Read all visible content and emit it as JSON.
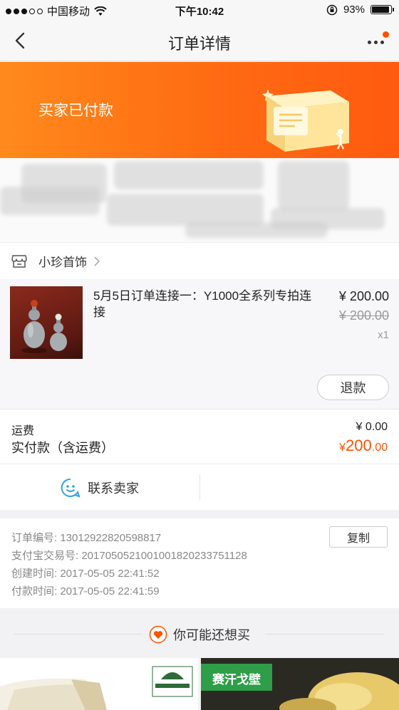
{
  "status_bar": {
    "carrier": "中国移动",
    "time": "下午10:42",
    "battery": "93%",
    "battery_level": 0.93
  },
  "nav": {
    "title": "订单详情"
  },
  "banner": {
    "status": "买家已付款"
  },
  "shop": {
    "name": "小珍首饰"
  },
  "product": {
    "name": "5月5日订单连接一：Y1000全系列专拍连接",
    "price": "¥ 200.00",
    "original_price": "¥ 200.00",
    "quantity": "x1",
    "refund_label": "退款"
  },
  "totals": {
    "shipping_label": "运费",
    "shipping_value": "¥ 0.00",
    "paid_label": "实付款（含运费）",
    "paid_currency": "¥",
    "paid_integer": "200",
    "paid_decimal": ".00"
  },
  "contact": {
    "label": "联系卖家"
  },
  "order_info": {
    "order_no": "订单编号:  13012922820598817",
    "alipay_no": "支付宝交易号:  2017050521001001820233751128",
    "created": "创建时间:  2017-05-05 22:41:52",
    "paid": "付款时间:  2017-05-05 22:41:59",
    "copy_label": "复制"
  },
  "recommend": {
    "title": "你可能还想买",
    "card2_text": "赛汗戈壁"
  },
  "colors": {
    "accent": "#ff5000",
    "banner_start": "#ff8a1c",
    "banner_end": "#ff5a10"
  }
}
